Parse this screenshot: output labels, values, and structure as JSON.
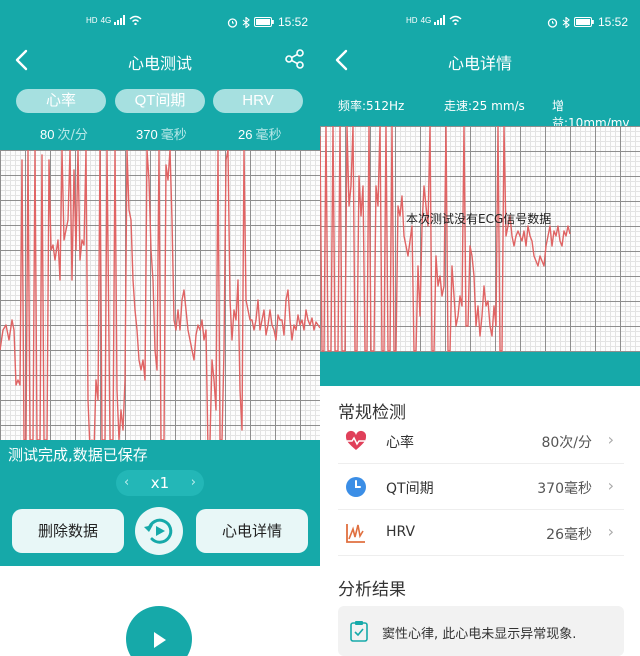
{
  "left": {
    "status": {
      "time": "15:52",
      "hd": "HD",
      "net": "4G"
    },
    "title": "心电测试",
    "tabs": [
      {
        "label": "心率",
        "value": "80",
        "unit": "次/分"
      },
      {
        "label": "QT间期",
        "value": "370",
        "unit": "毫秒"
      },
      {
        "label": "HRV",
        "value": "26",
        "unit": "毫秒"
      }
    ],
    "status_message": "测试完成,数据已保存",
    "speed": "x1",
    "delete_label": "删除数据",
    "detail_label": "心电详情"
  },
  "right": {
    "status": {
      "time": "15:52",
      "hd": "HD",
      "net": "4G"
    },
    "title": "心电详情",
    "params": {
      "sample_rate": "频率:512Hz",
      "paper_speed": "走速:25 mm/s",
      "gain": "增益:10mm/mv"
    },
    "no_signal_message": "本次测试没有ECG信号数据",
    "routine_title": "常规检测",
    "items": [
      {
        "icon": "heart-rate-icon",
        "label": "心率",
        "value": "80次/分"
      },
      {
        "icon": "clock-icon",
        "label": "QT间期",
        "value": "370毫秒"
      },
      {
        "icon": "hrv-chart-icon",
        "label": "HRV",
        "value": "26毫秒"
      }
    ],
    "analysis_title": "分析结果",
    "analysis_result": "窦性心律, 此心电未显示异常现象."
  },
  "colors": {
    "teal": "#16a9a9",
    "ecg_line": "#e06464",
    "tab_bg": "#a6e0e0"
  }
}
